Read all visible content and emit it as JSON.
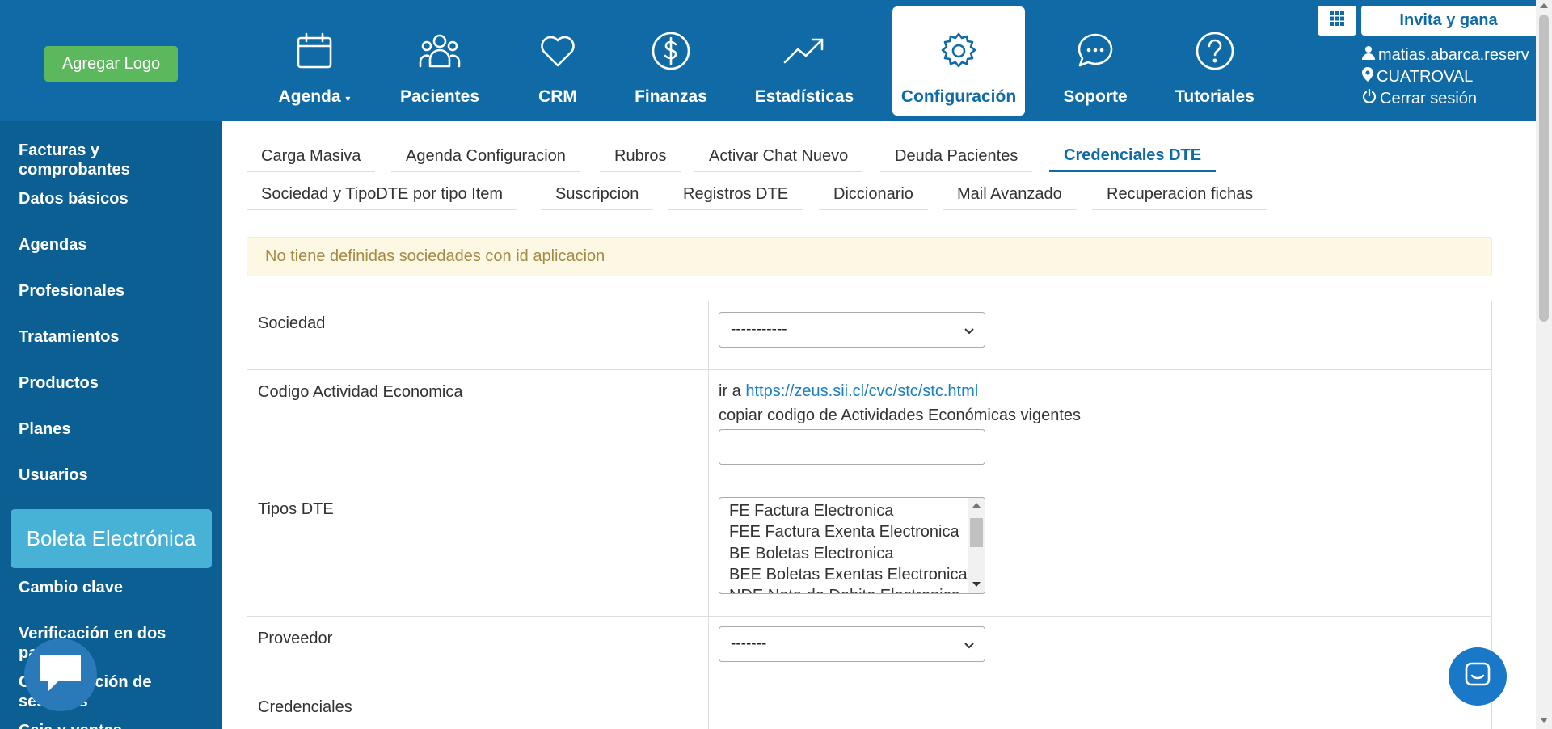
{
  "header": {
    "logo_button": "Agregar Logo",
    "nav": [
      {
        "label": "Agenda",
        "icon": "calendar-icon",
        "dropdown": true
      },
      {
        "label": "Pacientes",
        "icon": "users-icon"
      },
      {
        "label": "CRM",
        "icon": "heart-icon"
      },
      {
        "label": "Finanzas",
        "icon": "dollar-icon"
      },
      {
        "label": "Estadísticas",
        "icon": "trend-icon"
      },
      {
        "label": "Configuración",
        "icon": "gear-icon",
        "active": true
      },
      {
        "label": "Soporte",
        "icon": "chat-icon"
      },
      {
        "label": "Tutoriales",
        "icon": "question-icon"
      }
    ],
    "invite_button": "Invita y gana",
    "user": "matias.abarca.reserv",
    "location": "CUATROVAL",
    "logout": "Cerrar sesión"
  },
  "sidebar": {
    "items": [
      "Facturas y comprobantes",
      "Datos básicos",
      "Agendas",
      "Profesionales",
      "Tratamientos",
      "Productos",
      "Planes",
      "Usuarios",
      "Cambio clave",
      "Verificación en dos pasos",
      "Configuración de sesiones",
      "Caja y ventas"
    ],
    "highlight_button": "Boleta Electrónica"
  },
  "tabs": {
    "row1": [
      "Carga Masiva",
      "Agenda Configuracion",
      "Rubros",
      "Activar Chat Nuevo",
      "Deuda Pacientes",
      "Credenciales DTE"
    ],
    "row2": [
      "Sociedad y TipoDTE por tipo Item",
      "Suscripcion",
      "Registros DTE",
      "Diccionario",
      "Mail Avanzado",
      "Recuperacion fichas"
    ],
    "active": "Credenciales DTE"
  },
  "alert": "No tiene definidas sociedades con id aplicacion",
  "form": {
    "sociedad": {
      "label": "Sociedad",
      "value": "-----------"
    },
    "codigo": {
      "label": "Codigo Actividad Economica",
      "prefix": "ir a",
      "link": "https://zeus.sii.cl/cvc/stc/stc.html",
      "instruction": "copiar codigo de Actividades Económicas vigentes",
      "value": ""
    },
    "tipos": {
      "label": "Tipos DTE",
      "options": [
        "FE Factura Electronica",
        "FEE Factura Exenta Electronica",
        "BE Boletas Electronica",
        "BEE Boletas Exentas Electronica",
        "NDE Nota de Debito Electronica"
      ]
    },
    "proveedor": {
      "label": "Proveedor",
      "value": "-------"
    },
    "credenciales": {
      "label": "Credenciales"
    }
  },
  "colors": {
    "primary": "#0f6aa6",
    "sidebar": "#0c5f93",
    "logo_button": "#5cb85c",
    "highlight": "#47b2d6"
  }
}
